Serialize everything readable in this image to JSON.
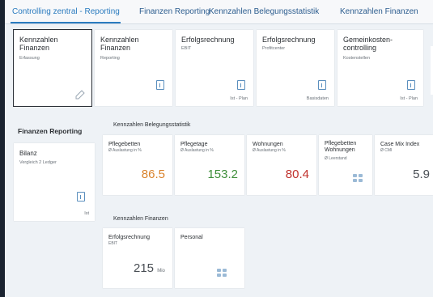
{
  "tabs": [
    {
      "label": "Controlling zentral - Reporting"
    },
    {
      "label": "Finanzen Reporting"
    },
    {
      "label": "Kennzahlen Belegungsstatistik"
    },
    {
      "label": "Kennzahlen Finanzen"
    }
  ],
  "top_tiles": [
    {
      "title": "Kennzahlen Finanzen",
      "subtitle": "Erfassung",
      "footer": "",
      "icon": "pencil-icon"
    },
    {
      "title": "Kennzahlen Finanzen",
      "subtitle": "Reporting",
      "footer": "",
      "icon": "document-icon"
    },
    {
      "title": "Erfolgsrechnung",
      "subtitle": "EBIT",
      "footer": "Ist - Plan",
      "icon": "document-icon"
    },
    {
      "title": "Erfolgsrechnung",
      "subtitle": "Profitcenter",
      "footer": "Basisdaten",
      "icon": "document-icon"
    },
    {
      "title": "Gemeinkosten-controlling",
      "subtitle": "Kostenstellen",
      "footer": "Ist - Plan",
      "icon": "document-icon"
    }
  ],
  "finanzen_reporting": {
    "heading": "Finanzen Reporting",
    "tile": {
      "title": "Bilanz",
      "subtitle": "Vergleich 2 Ledger",
      "footer": "Ist",
      "icon": "document-icon"
    }
  },
  "belegungsstatistik": {
    "heading": "Kennzahlen Belegungsstatistik",
    "tiles": [
      {
        "title": "Pflegebetten",
        "subtitle": "Ø Auslastung in %",
        "value": "86.5",
        "color": "#d9822b"
      },
      {
        "title": "Pflegetage",
        "subtitle": "Ø Auslastung in %",
        "value": "153.2",
        "color": "#3f8f3b"
      },
      {
        "title": "Wohnungen",
        "subtitle": "Ø Auslastung in %",
        "value": "80.4",
        "color": "#c0302b"
      },
      {
        "title": "Pflegebetten Wohnungen",
        "subtitle": "Ø Leerstand",
        "value": "",
        "color": ""
      },
      {
        "title": "Case Mix Index",
        "subtitle": "Ø CMI",
        "value": "5.9",
        "color": "#4a4f55"
      }
    ]
  },
  "finanzen": {
    "heading": "Kennzahlen Finanzen",
    "tiles": [
      {
        "title": "Erfolgsrechnung",
        "subtitle": "EBIT",
        "value": "215",
        "unit": "Mio"
      },
      {
        "title": "Personal",
        "subtitle": "",
        "value": "",
        "unit": ""
      }
    ]
  }
}
